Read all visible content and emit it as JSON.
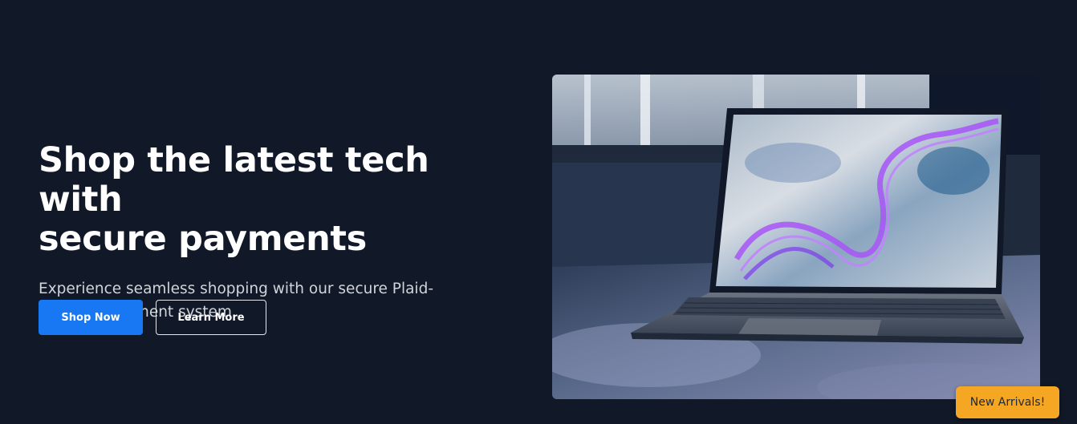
{
  "hero": {
    "title_line1": "Shop the latest tech with",
    "title_line2": "secure payments",
    "subtitle": "Experience seamless shopping with our secure Plaid-powered payment system.",
    "primary_button": "Shop Now",
    "secondary_button": "Learn More",
    "image_subject": "laptop-on-table"
  },
  "badge": {
    "label": "New Arrivals!"
  },
  "colors": {
    "background": "#111827",
    "primary": "#1877f2",
    "badge": "#f5a623",
    "text": "#ffffff",
    "muted_text": "#d1d5db"
  }
}
